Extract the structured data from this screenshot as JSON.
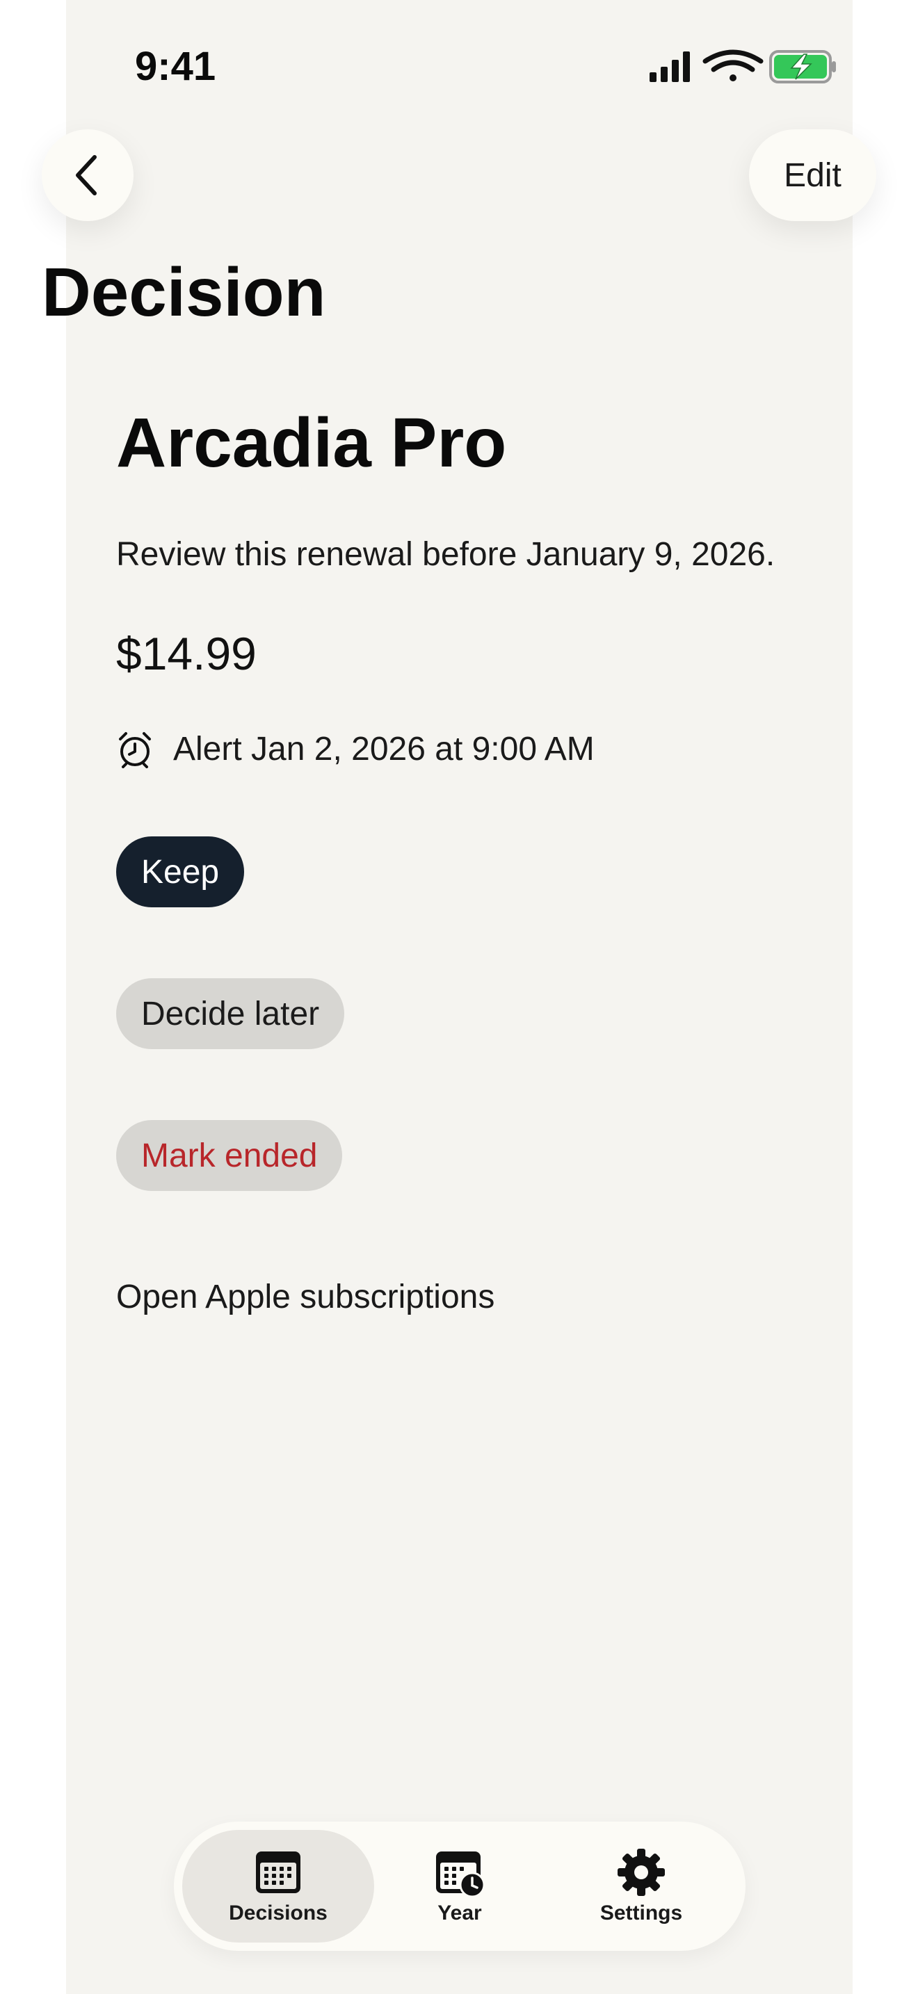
{
  "status_bar": {
    "time": "9:41"
  },
  "header": {
    "edit_label": "Edit",
    "title": "Decision"
  },
  "subscription": {
    "name": "Arcadia Pro",
    "description": "Review this renewal before January 9, 2026.",
    "price": "$14.99",
    "alert_text": "Alert Jan 2, 2026 at 9:00 AM"
  },
  "actions": {
    "keep": "Keep",
    "decide_later": "Decide later",
    "mark_ended": "Mark ended",
    "open_subscriptions": "Open Apple subscriptions"
  },
  "tabs": [
    {
      "label": "Decisions",
      "icon": "calendar-icon",
      "active": true
    },
    {
      "label": "Year",
      "icon": "calendar-clock-icon",
      "active": false
    },
    {
      "label": "Settings",
      "icon": "gear-icon",
      "active": false
    }
  ],
  "colors": {
    "background": "#f5f4f0",
    "primary_chip": "#15202d",
    "secondary_chip": "#d7d6d2",
    "destructive": "#b8262a",
    "battery": "#34c759"
  }
}
